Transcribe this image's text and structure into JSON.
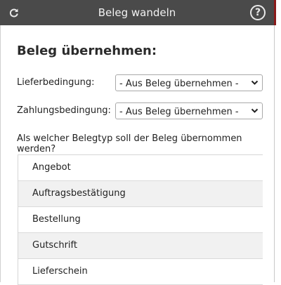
{
  "titlebar": {
    "title": "Beleg wandeln",
    "refresh_icon": "refresh-icon",
    "help_icon": "help-icon",
    "help_glyph": "?"
  },
  "form": {
    "heading": "Beleg übernehmen:",
    "delivery_label": "Lieferbedingung:",
    "delivery_value": "- Aus Beleg übernehmen -",
    "payment_label": "Zahlungsbedingung:",
    "payment_value": "- Aus Beleg übernehmen -",
    "question": "Als welcher Belegtyp soll der Beleg übernommen werden?"
  },
  "doc_types": [
    {
      "label": "Angebot"
    },
    {
      "label": "Auftragsbestätigung"
    },
    {
      "label": "Bestellung"
    },
    {
      "label": "Gutschrift"
    },
    {
      "label": "Lieferschein"
    }
  ],
  "colors": {
    "titlebar_bg": "#4a4a4a",
    "accent_red": "#8b1a1a",
    "row_alt_bg": "#f1f1f1"
  }
}
